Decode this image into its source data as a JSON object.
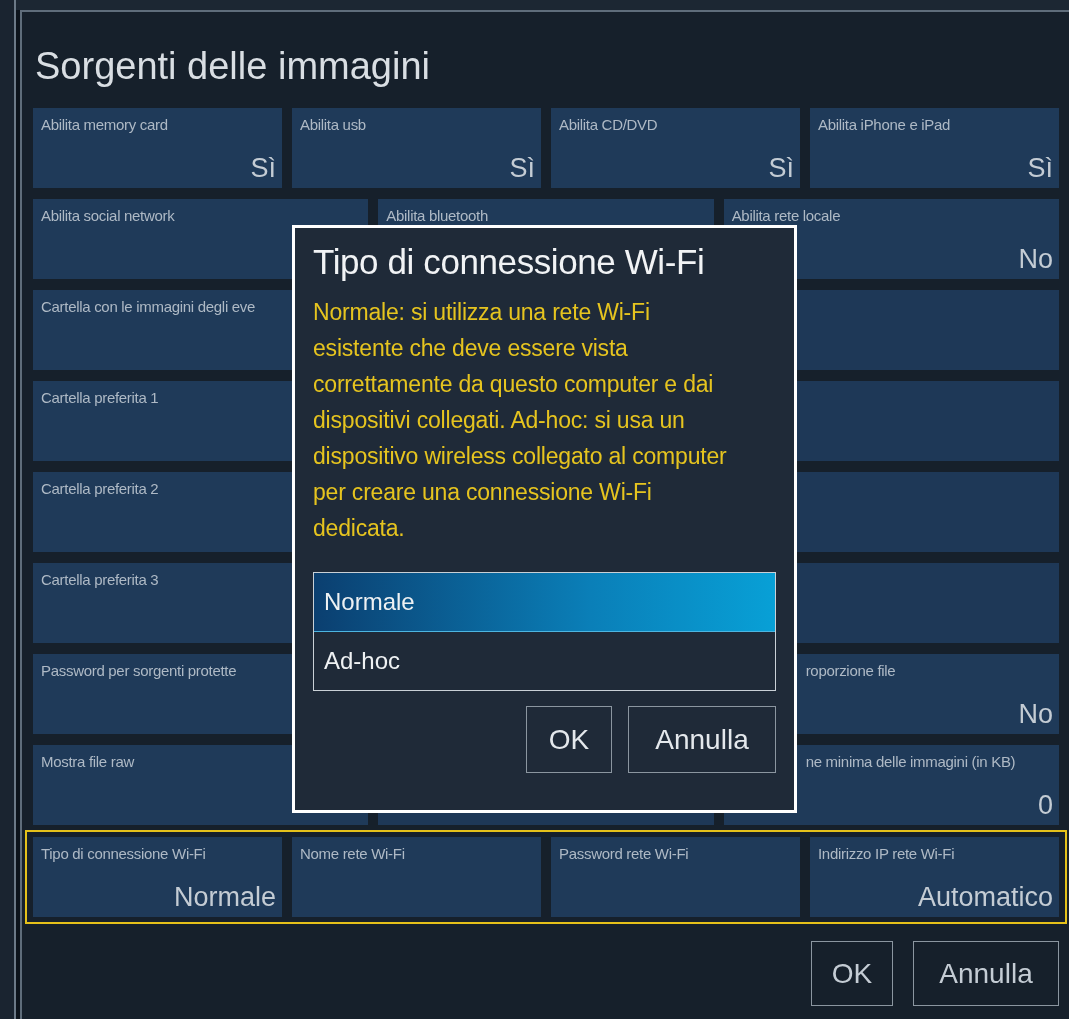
{
  "panel": {
    "title": "Sorgenti delle immagini",
    "rows": [
      {
        "highlighted": false,
        "tiles": [
          {
            "label": "Abilita memory card",
            "value": "Sì"
          },
          {
            "label": "Abilita usb",
            "value": "Sì"
          },
          {
            "label": "Abilita CD/DVD",
            "value": "Sì"
          },
          {
            "label": "Abilita iPhone e iPad",
            "value": "Sì"
          }
        ]
      },
      {
        "highlighted": false,
        "tiles": [
          {
            "label": "Abilita social network"
          },
          {
            "label": "Abilita bluetooth"
          },
          {
            "label": "Abilita rete locale",
            "value": "No"
          }
        ]
      },
      {
        "highlighted": false,
        "tiles": [
          {
            "label": "Cartella con le immagini degli eve"
          },
          {
            "kind": "blank"
          }
        ]
      },
      {
        "highlighted": false,
        "tiles": [
          {
            "label": "Cartella preferita 1"
          },
          {
            "kind": "blank"
          }
        ]
      },
      {
        "highlighted": false,
        "tiles": [
          {
            "label": "Cartella preferita 2"
          },
          {
            "kind": "blank"
          }
        ]
      },
      {
        "highlighted": false,
        "tiles": [
          {
            "label": "Cartella preferita 3"
          },
          {
            "kind": "blank"
          }
        ]
      },
      {
        "highlighted": false,
        "tiles": [
          {
            "label": "Password per sorgenti protette"
          },
          {
            "label": "roporzione file",
            "value": "No",
            "clipped": true
          }
        ]
      },
      {
        "highlighted": false,
        "tiles": [
          {
            "label": "Mostra file raw"
          },
          {
            "kind": "blank"
          },
          {
            "label": "ne minima delle immagini (in KB)",
            "value": "0",
            "clipped": true
          }
        ]
      },
      {
        "highlighted": true,
        "tiles": [
          {
            "label": "Tipo di connessione Wi-Fi",
            "value": "Normale"
          },
          {
            "label": "Nome rete Wi-Fi"
          },
          {
            "label": "Password rete Wi-Fi"
          },
          {
            "label": "Indirizzo IP rete Wi-Fi",
            "value": "Automatico"
          }
        ]
      }
    ],
    "buttons": [
      "OK",
      "Annulla"
    ]
  },
  "dialog": {
    "title": "Tipo di connessione Wi-Fi",
    "description": "Normale: si utilizza una rete Wi-Fi esistente che deve essere vista correttamente da questo computer e dai dispositivi collegati. Ad-hoc: si usa un dispositivo wireless collegato al computer per creare una connessione Wi-Fi dedicata.",
    "options": [
      {
        "label": "Normale",
        "selected": true
      },
      {
        "label": "Ad-hoc",
        "selected": false
      }
    ],
    "buttons": [
      "OK",
      "Annulla"
    ]
  }
}
